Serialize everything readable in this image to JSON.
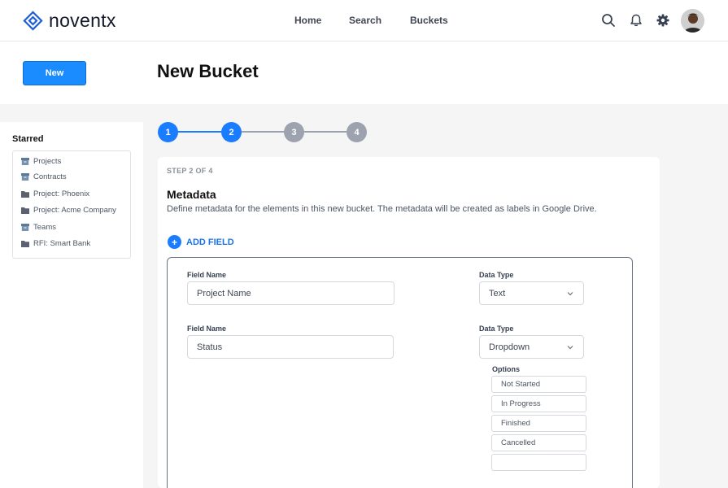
{
  "header": {
    "logo_text": "noventx",
    "nav": [
      {
        "label": "Home"
      },
      {
        "label": "Search"
      },
      {
        "label": "Buckets"
      }
    ],
    "icons": [
      "search-icon",
      "bell-icon",
      "gear-icon",
      "avatar"
    ]
  },
  "toolbar": {
    "new_label": "New",
    "page_title": "New Bucket"
  },
  "sidebar": {
    "title": "Starred",
    "items": [
      {
        "label": "Projects",
        "icon": "archive-icon"
      },
      {
        "label": "Contracts",
        "icon": "archive-icon"
      },
      {
        "label": "Project: Phoenix",
        "icon": "folder-icon"
      },
      {
        "label": "Project: Acme Company",
        "icon": "folder-icon"
      },
      {
        "label": "Teams",
        "icon": "archive-icon"
      },
      {
        "label": "RFI: Smart Bank",
        "icon": "folder-icon"
      }
    ]
  },
  "stepper": {
    "steps": [
      "1",
      "2",
      "3",
      "4"
    ],
    "current": 2,
    "colors": {
      "active": "#1a7dff",
      "inactive": "#9ca3af"
    }
  },
  "form": {
    "step_label": "STEP 2 OF 4",
    "title": "Metadata",
    "description": "Define metadata for the elements in this new bucket. The metadata will be created as labels in Google Drive.",
    "add_field_label": "ADD FIELD",
    "field_name_label": "Field Name",
    "data_type_label": "Data Type",
    "options_label": "Options",
    "fields": [
      {
        "name": "Project Name",
        "type": "Text"
      },
      {
        "name": "Status",
        "type": "Dropdown",
        "options": [
          "Not Started",
          "In Progress",
          "Finished",
          "Cancelled",
          ""
        ]
      }
    ]
  },
  "colors": {
    "primary": "#1a8cff",
    "link": "#1a73e8"
  }
}
